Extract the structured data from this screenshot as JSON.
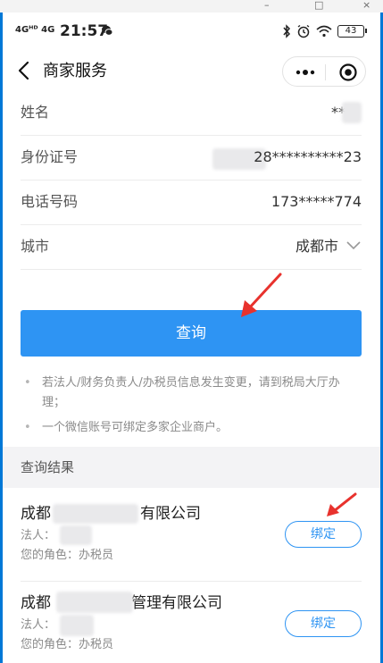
{
  "window": {
    "minimize_glyph": "–",
    "maximize_glyph": "□",
    "close_glyph": "×"
  },
  "status_bar": {
    "network": "4Gᴴᴰ 4G",
    "time": "21:57",
    "battery": "43",
    "icons": [
      "wechat-notification-icon",
      "bluetooth-icon",
      "alarm-icon",
      "wifi-icon",
      "battery-icon"
    ]
  },
  "nav": {
    "title": "商家服务",
    "back_icon": "chevron-left-icon",
    "more_icon": "more-dots-icon",
    "close_icon": "target-circle-icon"
  },
  "form": {
    "name": {
      "label": "姓名",
      "value": "**"
    },
    "id_number": {
      "label": "身份证号",
      "value": "28**********23"
    },
    "phone": {
      "label": "电话号码",
      "value": "173*****774"
    },
    "city": {
      "label": "城市",
      "value": "成都市"
    }
  },
  "query_button": "查询",
  "notes": [
    "若法人/财务负责人/办税员信息发生变更，请到税局大厅办理；",
    "一个微信账号可绑定多家企业商户。"
  ],
  "results": {
    "header": "查询结果",
    "items": [
      {
        "company_prefix": "成都",
        "company_suffix": "有限公司",
        "legal_label": "法人：",
        "legal_value": "",
        "role": "您的角色：办税员",
        "bind_label": "绑定"
      },
      {
        "company_prefix": "成都",
        "company_suffix": "管理有限公司",
        "legal_label": "法人：",
        "legal_value": "",
        "role": "您的角色：办税员",
        "bind_label": "绑定"
      }
    ]
  },
  "colors": {
    "primary": "#2e94f3",
    "annotation_arrow": "#e8322d",
    "divider": "#ececec"
  }
}
